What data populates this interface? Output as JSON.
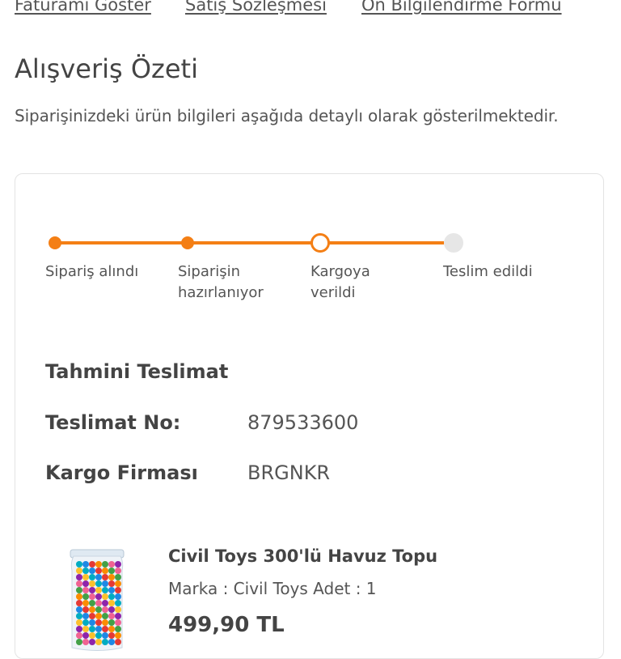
{
  "top_links": [
    "Faturamı Göster",
    "Satış Sözleşmesi",
    "Ön Bilgilendirme Formu"
  ],
  "page": {
    "title": "Alışveriş Özeti",
    "subtitle": "Siparişinizdeki ürün bilgileri aşağıda detaylı olarak gösterilmektedir."
  },
  "tracker": {
    "accent_color": "#f47f15",
    "pending_color": "#e6e6e6",
    "steps": [
      {
        "label": "Sipariş alındı",
        "state": "done"
      },
      {
        "label": "Siparişin hazırlanıyor",
        "state": "done"
      },
      {
        "label": "Kargoya verildi",
        "state": "current"
      },
      {
        "label": "Teslim edildi",
        "state": "pending"
      }
    ]
  },
  "delivery": {
    "heading": "Tahmini Teslimat",
    "tracking_label": "Teslimat No:",
    "tracking_value": "879533600",
    "carrier_label": "Kargo Firması",
    "carrier_value": "BRGNKR"
  },
  "product": {
    "name": "Civil Toys 300'lü Havuz Topu",
    "meta": "Marka : Civil Toys  Adet : 1",
    "price": "499,90 TL"
  }
}
